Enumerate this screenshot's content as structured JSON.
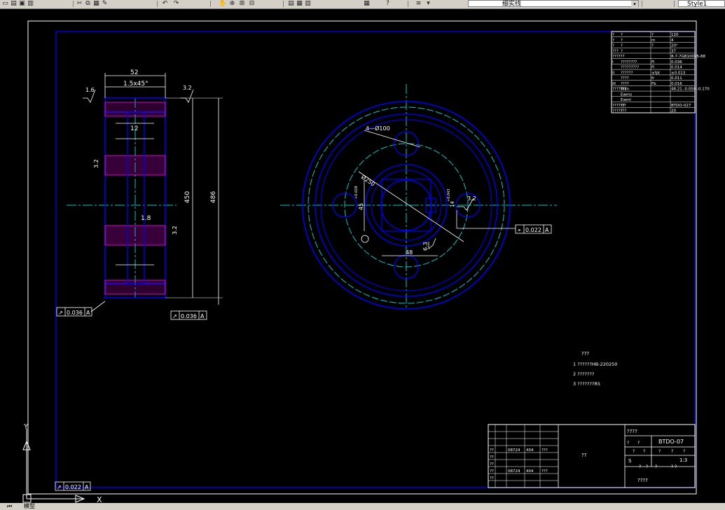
{
  "toolbar": {
    "layer_value": "细实线",
    "style_value": "Style1",
    "combo_arrow_glyph": "▾",
    "icons": [
      "new-icon",
      "open-icon",
      "save-icon",
      "print-icon",
      "cut-icon",
      "copy-icon",
      "paste-icon",
      "match-properties-icon",
      "undo-icon",
      "redo-icon",
      "pan-icon",
      "zoom-realtime-icon",
      "zoom-window-icon",
      "zoom-previous-icon",
      "properties-icon",
      "design-center-icon",
      "tool-palettes-icon",
      "calculator-icon",
      "help-icon",
      "layer-manager-icon",
      "layer-state-icon"
    ]
  },
  "bottom_tabs": {
    "model": "模型"
  },
  "drawing": {
    "side_view": {
      "width_dim": "52",
      "chamfer": "1.5x45°",
      "hub_width": "12",
      "bore_depth": "1.8",
      "dia_inner": "450",
      "dia_outer": "486",
      "rough_left": "1.6",
      "rough_right": "3.2",
      "rough_side": "3.2",
      "rough_web": "3.2",
      "tol_left": {
        "symbol": "↗",
        "value": "0.036",
        "datum": "A"
      },
      "tol_right": {
        "symbol": "↗",
        "value": "0.036",
        "datum": "A"
      }
    },
    "front_view": {
      "holes_note": "4—Ø100",
      "pcd": "Ø250",
      "bore_dim": "45",
      "bore_tol": "+0.028",
      "key_width": "48",
      "key_height": "14",
      "key_tol": "+0.043",
      "rough_key": "3.2",
      "rough_bore": "6.3",
      "tol_frame": {
        "symbol": "⌖",
        "value": "0.022",
        "datum": "A"
      }
    },
    "bottom_tol": {
      "symbol": "↗",
      "value": "0.022",
      "datum": "A"
    },
    "params_table": {
      "rows": [
        [
          "?",
          "?",
          "?",
          "120"
        ],
        [
          "?",
          "?",
          "m",
          "4"
        ],
        [
          "?",
          "?",
          "?",
          "20°"
        ],
        [
          "???",
          "?",
          "",
          "37"
        ],
        [
          "??????",
          "",
          "",
          "8-7-7GB10095-88"
        ],
        [
          "I",
          "????????",
          "Fi",
          "0.036"
        ],
        [
          "",
          "?????????",
          "Fi",
          "0.014"
        ],
        [
          "II",
          "??????",
          "±fpt",
          "±0.013"
        ],
        [
          "",
          "????",
          "fr",
          "0.011"
        ],
        [
          "III",
          "????",
          "Fb",
          "0.016"
        ],
        [
          "???????",
          "Wkn",
          "",
          "48.21 -0.050 -0.170"
        ],
        [
          "",
          "Ewms",
          "",
          ""
        ],
        [
          "",
          "Ewmi",
          "",
          ""
        ],
        [
          "??????",
          "?/?",
          "",
          "BTDO-027"
        ],
        [
          "???????",
          "?",
          "",
          "20"
        ]
      ]
    },
    "notes": {
      "title": "???",
      "items": [
        "1 ??????HB-220250",
        "2 ???????",
        "3 ???????R5"
      ]
    },
    "title_block": {
      "drawing_no": "BTDO-07",
      "org": "????",
      "part": "??",
      "scale": "1:3",
      "material": "S",
      "sheet_label": "????",
      "rows": [
        [
          "??",
          "08724",
          "404",
          "???"
        ],
        [
          "??",
          "",
          "",
          ""
        ],
        [
          "??",
          "",
          "",
          ""
        ],
        [
          "??",
          "08724",
          "404",
          "???"
        ],
        [
          "??",
          "",
          "",
          ""
        ]
      ],
      "cells": [
        "?",
        "?",
        "?",
        "?",
        "?",
        "?",
        "?",
        "?",
        "?",
        "?",
        "? ?"
      ]
    },
    "ucs": {
      "x_label": "X",
      "y_label": "Y"
    }
  },
  "colors": {
    "background": "#000000",
    "border": "#0000ff",
    "lines": "#ffffff",
    "center": "#00c8c8",
    "hatch": "#ff00ff",
    "outline": "#0000ff"
  }
}
